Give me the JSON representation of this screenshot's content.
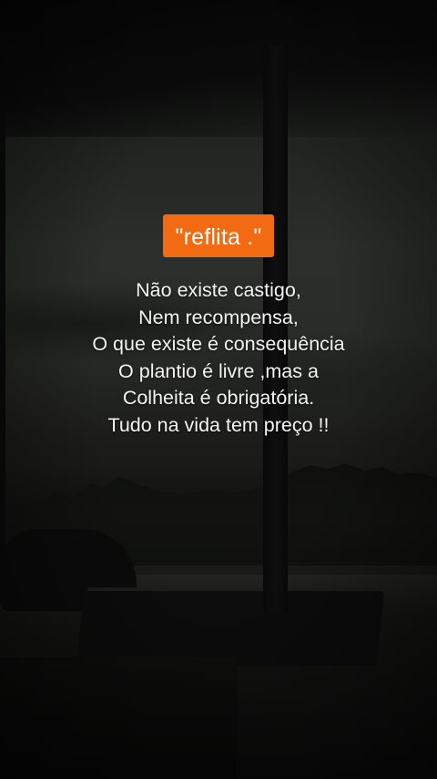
{
  "tag": "\"reflita .\"",
  "quote_lines": [
    "Não existe castigo,",
    "Nem recompensa,",
    "O que existe é consequência",
    "O plantio é livre ,mas a",
    "Colheita é obrigatória.",
    "Tudo na vida tem preço !!"
  ],
  "colors": {
    "tag_background": "#f26b12",
    "text": "#f4f4f4",
    "background": "#151614"
  }
}
